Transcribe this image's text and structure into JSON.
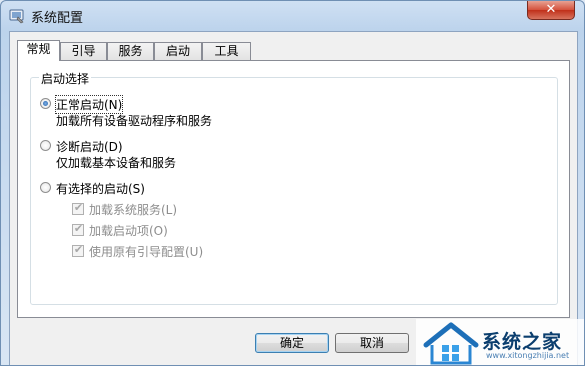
{
  "window": {
    "title": "系统配置",
    "close_label": "✕"
  },
  "tabs": [
    {
      "label": "常规",
      "active": true
    },
    {
      "label": "引导",
      "active": false
    },
    {
      "label": "服务",
      "active": false
    },
    {
      "label": "启动",
      "active": false
    },
    {
      "label": "工具",
      "active": false
    }
  ],
  "startup_group": {
    "legend": "启动选择",
    "options": [
      {
        "label": "正常启动(N)",
        "description": "加载所有设备驱动程序和服务",
        "checked": true
      },
      {
        "label": "诊断启动(D)",
        "description": "仅加载基本设备和服务",
        "checked": false
      },
      {
        "label": "有选择的启动(S)",
        "checked": false
      }
    ],
    "selective_items": [
      {
        "label": "加载系统服务(L)",
        "checked": true,
        "enabled": false
      },
      {
        "label": "加载启动项(O)",
        "checked": true,
        "enabled": false
      },
      {
        "label": "使用原有引导配置(U)",
        "checked": true,
        "enabled": false
      }
    ]
  },
  "buttons": {
    "ok": "确定",
    "cancel": "取消"
  },
  "watermark": {
    "text": "系统之家",
    "url": "www.xitongzhijia.net"
  },
  "colors": {
    "title_bar": "#bcd3ec",
    "close_button": "#c0301a",
    "radio_selected": "#1f5fa8",
    "watermark_text": "#0b3e6e"
  }
}
